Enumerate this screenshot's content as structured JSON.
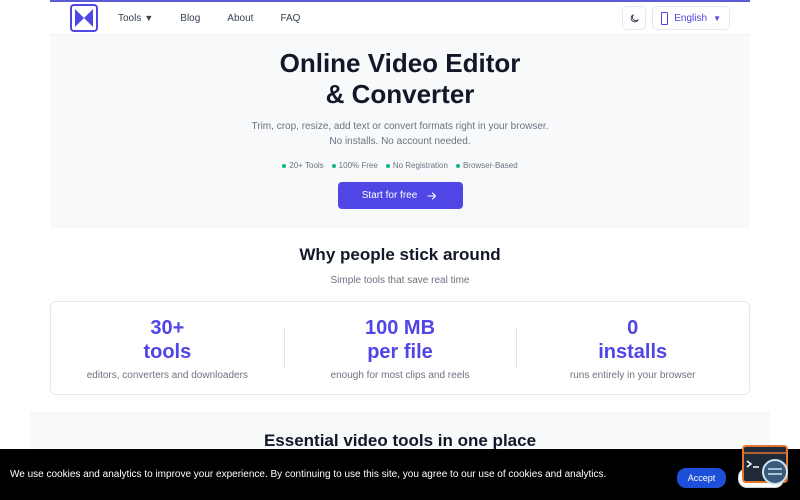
{
  "nav": {
    "items": [
      {
        "label": "Tools",
        "caret": "▼"
      },
      {
        "label": "Blog"
      },
      {
        "label": "About"
      },
      {
        "label": "FAQ"
      }
    ],
    "language": "English",
    "language_caret": "▼"
  },
  "hero": {
    "title_line1": "Online Video Editor",
    "title_line2": "& Converter",
    "subtitle_line1": "Trim, crop, resize, add text or convert formats right in your browser.",
    "subtitle_line2": "No installs. No account needed.",
    "features": [
      "20+ Tools",
      "100% Free",
      "No Registration",
      "Browser-Based"
    ],
    "cta_label": "Start for free"
  },
  "why": {
    "title": "Why people stick around",
    "subtitle": "Simple tools that save real time",
    "stats": [
      {
        "value": "30+",
        "unit": "tools",
        "desc": "editors, converters and downloaders"
      },
      {
        "value": "100 MB",
        "unit": "per file",
        "desc": "enough for most clips and reels"
      },
      {
        "value": "0",
        "unit": "installs",
        "desc": "runs entirely in your browser"
      }
    ]
  },
  "tools": {
    "title": "Essential video tools in one place"
  },
  "cookie": {
    "text": "We use cookies and analytics to improve your experience. By continuing to use this site, you agree to our use of cookies and analytics.",
    "accept_label": "Accept",
    "decline_label": "Decl"
  },
  "colors": {
    "accent": "#4f46e5",
    "feature_dot": "#10b981",
    "accept_button": "#1e4fd8"
  }
}
